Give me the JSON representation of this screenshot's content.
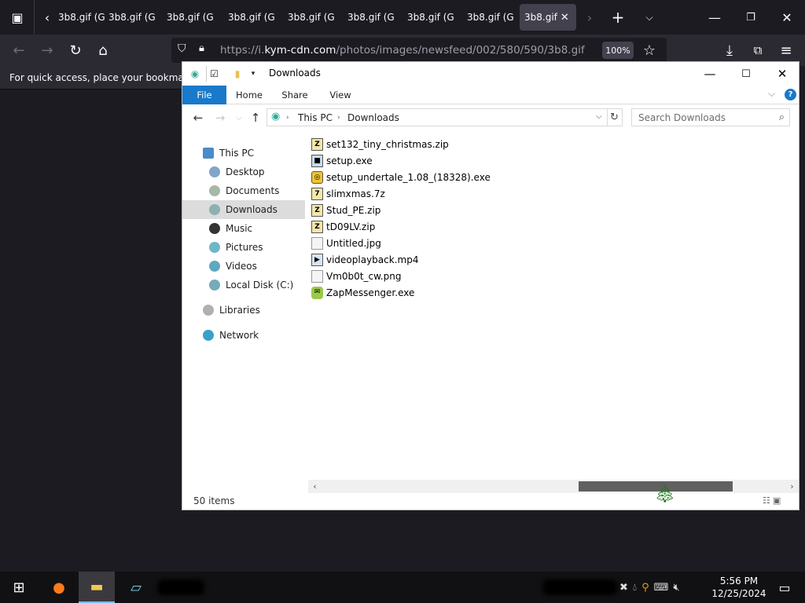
{
  "browser": {
    "tabs": [
      "3b8.gif (G",
      "3b8.gif (G",
      "3b8.gif (G",
      "3b8.gif (G",
      "3b8.gif (G",
      "3b8.gif (G",
      "3b8.gif (G",
      "3b8.gif"
    ],
    "url_prefix": "https://i.",
    "url_domain": "kym-cdn.com",
    "url_path": "/photos/images/newsfeed/002/580/590/3b8.gif",
    "zoom": "100%",
    "bookmarks_hint": "For quick access, place your bookmarks h"
  },
  "explorer": {
    "title": "Downloads",
    "ribbon_tabs": [
      "File",
      "Home",
      "Share",
      "View"
    ],
    "address": [
      "This PC",
      "Downloads"
    ],
    "search_placeholder": "Search Downloads",
    "nav": [
      {
        "label": "This PC",
        "level": 0
      },
      {
        "label": "Desktop",
        "level": 1
      },
      {
        "label": "Documents",
        "level": 1
      },
      {
        "label": "Downloads",
        "level": 1,
        "selected": true
      },
      {
        "label": "Music",
        "level": 1
      },
      {
        "label": "Pictures",
        "level": 1
      },
      {
        "label": "Videos",
        "level": 1
      },
      {
        "label": "Local Disk (C:)",
        "level": 1
      },
      {
        "label": "Libraries",
        "level": 0
      },
      {
        "label": "Network",
        "level": 0
      }
    ],
    "files": [
      {
        "name": "set132_tiny_christmas.zip",
        "icon": "zip-icon"
      },
      {
        "name": "setup.exe",
        "icon": "exe-icon"
      },
      {
        "name": "setup_undertale_1.08_(18328).exe",
        "icon": "installer-icon"
      },
      {
        "name": "slimxmas.7z",
        "icon": "zip-icon"
      },
      {
        "name": "Stud_PE.zip",
        "icon": "zip-icon"
      },
      {
        "name": "tD09LV.zip",
        "icon": "zip-icon"
      },
      {
        "name": "Untitled.jpg",
        "icon": "image-icon"
      },
      {
        "name": "videoplayback.mp4",
        "icon": "video-icon"
      },
      {
        "name": "Vm0b0t_cw.png",
        "icon": "image-icon"
      },
      {
        "name": "ZapMessenger.exe",
        "icon": "app-icon"
      }
    ],
    "status_count": "50 items"
  },
  "taskbar": {
    "time": "5:56 PM",
    "date": "12/25/2024"
  }
}
